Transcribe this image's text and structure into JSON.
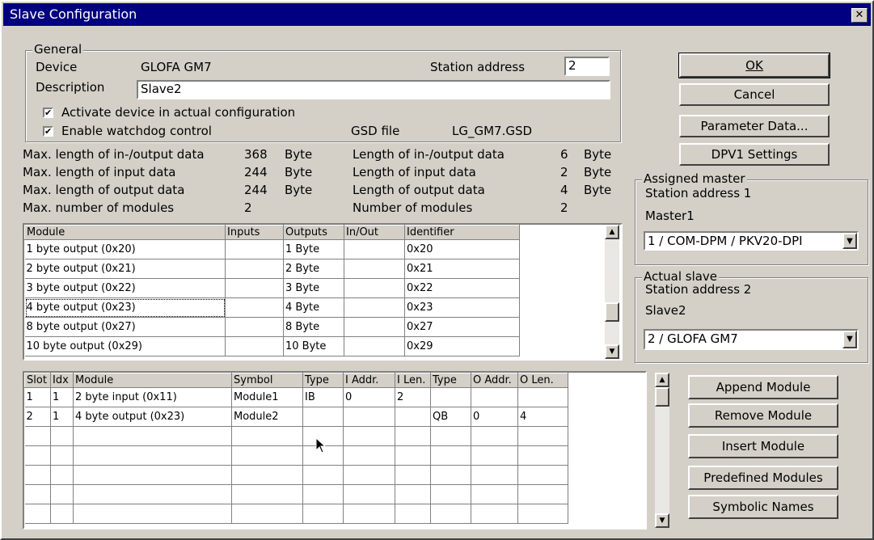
{
  "window": {
    "title": "Slave Configuration",
    "close": "✕"
  },
  "general": {
    "group_label": "General",
    "device_label": "Device",
    "device_value": "GLOFA GM7",
    "station_label": "Station address",
    "station_value": "2",
    "description_label": "Description",
    "description_value": "Slave2",
    "activate_label": "Activate device in actual configuration",
    "activate_checked": true,
    "watchdog_label": "Enable watchdog control",
    "watchdog_checked": true,
    "gsd_label": "GSD file",
    "gsd_value": "LG_GM7.GSD"
  },
  "stats": {
    "left": [
      {
        "label": "Max. length of in-/output data",
        "value": "368",
        "unit": "Byte"
      },
      {
        "label": "Max. length of input data",
        "value": "244",
        "unit": "Byte"
      },
      {
        "label": "Max. length of output data",
        "value": "244",
        "unit": "Byte"
      },
      {
        "label": "Max. number of modules",
        "value": "2",
        "unit": ""
      }
    ],
    "right": [
      {
        "label": "Length of in-/output data",
        "value": "6",
        "unit": "Byte"
      },
      {
        "label": "Length of input data",
        "value": "2",
        "unit": "Byte"
      },
      {
        "label": "Length of output data",
        "value": "4",
        "unit": "Byte"
      },
      {
        "label": "Number of modules",
        "value": "2",
        "unit": ""
      }
    ]
  },
  "module_list": {
    "headers": [
      "Module",
      "Inputs",
      "Outputs",
      "In/Out",
      "Identifier"
    ],
    "rows": [
      [
        "1  byte output  (0x20)",
        "",
        "1 Byte",
        "",
        "0x20"
      ],
      [
        "2  byte output  (0x21)",
        "",
        "2 Byte",
        "",
        "0x21"
      ],
      [
        "3  byte output  (0x22)",
        "",
        "3 Byte",
        "",
        "0x22"
      ],
      [
        "4  byte output  (0x23)",
        "",
        "4 Byte",
        "",
        "0x23"
      ],
      [
        "8  byte output  (0x27)",
        "",
        "8 Byte",
        "",
        "0x27"
      ],
      [
        "10 byte output  (0x29)",
        "",
        "10 Byte",
        "",
        "0x29"
      ]
    ],
    "selected_index": 3
  },
  "slot_table": {
    "headers": [
      "Slot",
      "Idx",
      "Module",
      "Symbol",
      "Type",
      "I Addr.",
      "I Len.",
      "Type",
      "O Addr.",
      "O Len."
    ],
    "rows": [
      [
        "1",
        "1",
        "2  byte input   (0x11)",
        "Module1",
        "IB",
        "0",
        "2",
        "",
        "",
        ""
      ],
      [
        "2",
        "1",
        "4  byte output  (0x23)",
        "Module2",
        "",
        "",
        "",
        "QB",
        "0",
        "4"
      ],
      [
        "",
        "",
        "",
        "",
        "",
        "",
        "",
        "",
        "",
        ""
      ],
      [
        "",
        "",
        "",
        "",
        "",
        "",
        "",
        "",
        "",
        ""
      ],
      [
        "",
        "",
        "",
        "",
        "",
        "",
        "",
        "",
        "",
        ""
      ],
      [
        "",
        "",
        "",
        "",
        "",
        "",
        "",
        "",
        "",
        ""
      ],
      [
        "",
        "",
        "",
        "",
        "",
        "",
        "",
        "",
        "",
        ""
      ]
    ]
  },
  "buttons": {
    "ok": "OK",
    "cancel": "Cancel",
    "parameter": "Parameter Data...",
    "dpv1": "DPV1 Settings",
    "append": "Append Module",
    "remove": "Remove Module",
    "insert": "Insert Module",
    "predefined": "Predefined Modules",
    "symbolic": "Symbolic Names"
  },
  "assigned_master": {
    "group_label": "Assigned master",
    "station": "Station address 1",
    "name": "Master1",
    "combo_value": "1 / COM-DPM / PKV20-DPI"
  },
  "actual_slave": {
    "group_label": "Actual slave",
    "station": "Station address 2",
    "name": "Slave2",
    "combo_value": "2 / GLOFA GM7"
  },
  "icons": {
    "checkbox": "✔",
    "arrow_up": "▲",
    "arrow_down": "▼"
  }
}
